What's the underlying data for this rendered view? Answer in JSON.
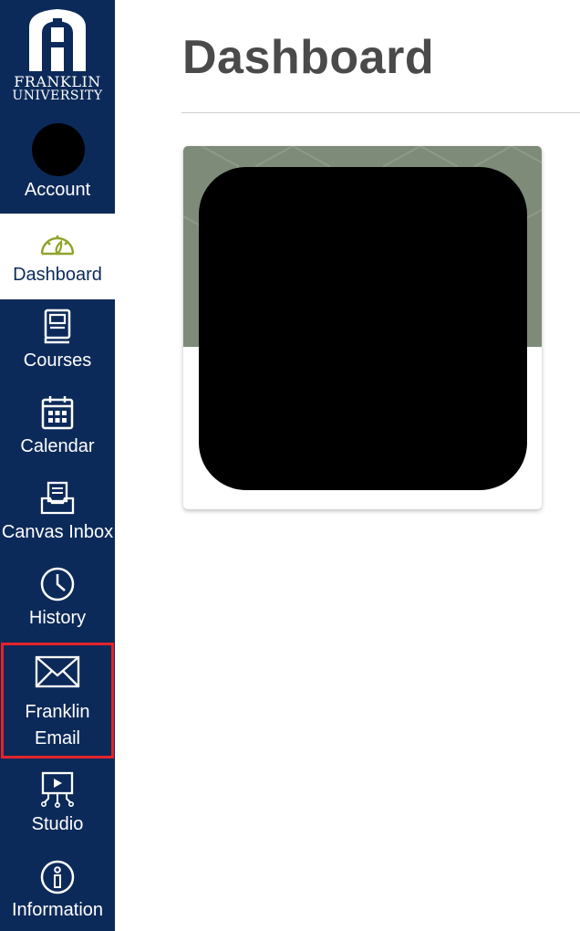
{
  "brand": {
    "line1": "FRANKLIN",
    "line2": "UNIVERSITY",
    "sidebar_color": "#0c2a59",
    "accent_green": "#8fa52b"
  },
  "nav": {
    "account": "Account",
    "dashboard": "Dashboard",
    "courses": "Courses",
    "calendar": "Calendar",
    "inbox": "Canvas Inbox",
    "history": "History",
    "email_line1": "Franklin",
    "email_line2": "Email",
    "studio": "Studio",
    "information": "Information"
  },
  "main": {
    "title": "Dashboard"
  },
  "highlight_color": "#e3232b"
}
